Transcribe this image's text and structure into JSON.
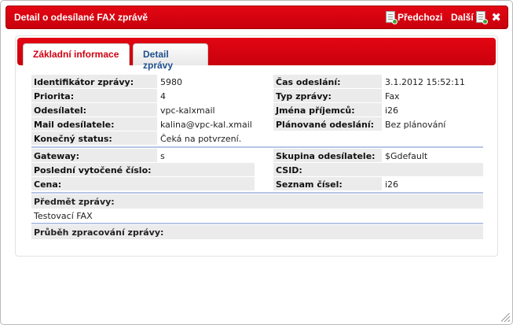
{
  "dialog": {
    "title": "Detail o odesílané FAX zprávě",
    "prev_label": "Předchozi",
    "next_label": "Další",
    "close_glyph": "✖"
  },
  "tabs": [
    {
      "label": "Základní informace",
      "active": true
    },
    {
      "label": "Detail zprávy",
      "active": false
    }
  ],
  "info_left": [
    {
      "label": "Identifikátor zprávy:",
      "value": "5980"
    },
    {
      "label": "Priorita:",
      "value": "4"
    },
    {
      "label": "Odesílatel:",
      "value": "vpc-kalxmail"
    },
    {
      "label": "Mail odesílatele:",
      "value": "kalina@vpc-kal.xmail"
    },
    {
      "label": "Konečný status:",
      "value": "Čeká na potvrzení."
    }
  ],
  "info_right": [
    {
      "label": "Čas odeslání:",
      "value": "3.1.2012 15:52:11"
    },
    {
      "label": "Typ zprávy:",
      "value": "Fax"
    },
    {
      "label": "Jména příjemců:",
      "value": "i26"
    },
    {
      "label": "Plánované odeslání:",
      "value": "Bez plánování"
    }
  ],
  "gateway_left": [
    {
      "label": "Gateway:",
      "value": "s"
    },
    {
      "label": "Poslední vytočené číslo:",
      "value": ""
    },
    {
      "label": "Cena:",
      "value": ""
    }
  ],
  "gateway_right": [
    {
      "label": "Skupina odesílatele:",
      "value": "$Gdefault"
    },
    {
      "label": "CSID:",
      "value": ""
    },
    {
      "label": "Seznam čísel:",
      "value": "i26"
    }
  ],
  "subject": {
    "label": "Předmět zprávy:",
    "value": "Testovací FAX"
  },
  "progress": {
    "label": "Průběh zpracování zprávy:"
  }
}
